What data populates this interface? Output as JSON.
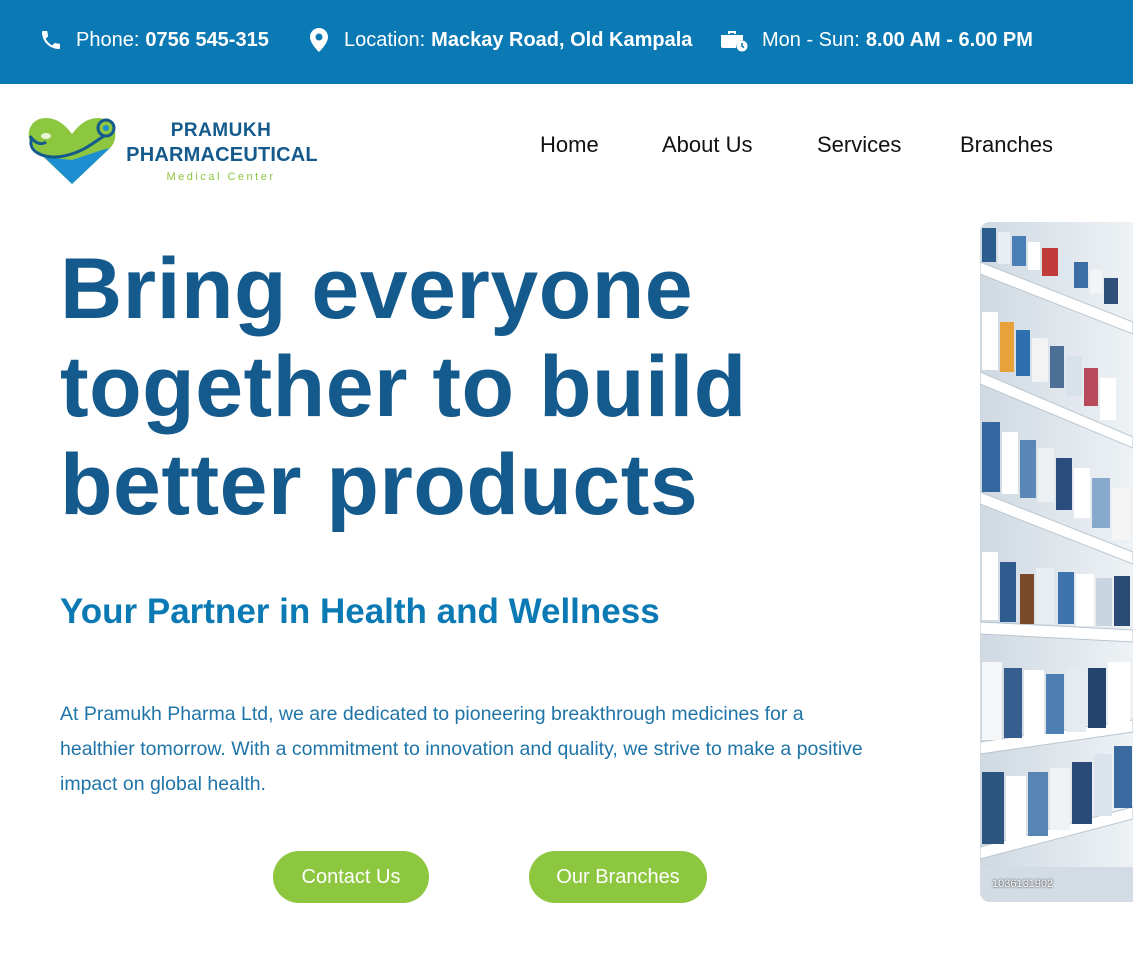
{
  "topbar": {
    "phone": {
      "label": "Phone:",
      "value": "0756 545-315",
      "icon": "phone-icon"
    },
    "location": {
      "label": "Location:",
      "value": "Mackay Road, Old Kampala",
      "icon": "map-pin-icon"
    },
    "hours": {
      "label": "Mon - Sun:",
      "value": "8.00 AM - 6.00 PM",
      "icon": "briefcase-clock-icon"
    }
  },
  "logo": {
    "line1": "PRAMUKH",
    "line2": "PHARMACEUTICAL",
    "line3": "Medical Center"
  },
  "nav": {
    "items": [
      {
        "label": "Home"
      },
      {
        "label": "About Us"
      },
      {
        "label": "Services"
      },
      {
        "label": "Branches"
      }
    ]
  },
  "hero": {
    "title_line1": "Bring everyone",
    "title_line2": "together to build",
    "title_line3": "better products",
    "subtitle": "Your Partner in Health and Wellness",
    "paragraph": "At Pramukh Pharma Ltd, we are dedicated to pioneering breakthrough medicines for a healthier tomorrow. With a commitment to innovation and quality, we strive to make a positive impact on global health.",
    "buttons": {
      "contact": "Contact Us",
      "branches": "Our Branches"
    },
    "image_caption": "1036131902"
  },
  "colors": {
    "primary": "#0b7ab4",
    "dark_blue": "#145a8c",
    "accent_green": "#8dc63f"
  }
}
